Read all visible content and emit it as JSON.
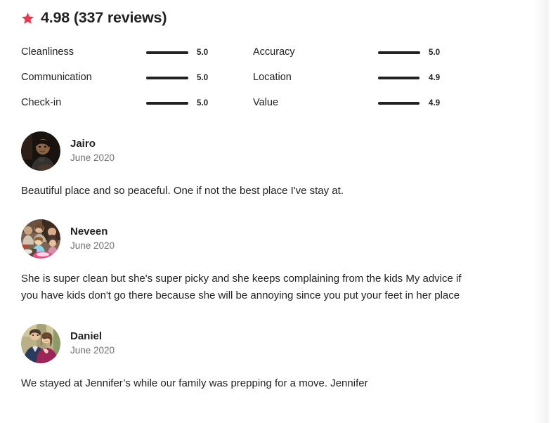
{
  "header": {
    "star_icon": "star-icon",
    "star_color": "#E8384F",
    "summary": "4.98 (337 reviews)",
    "rating_value": "4.98",
    "review_count": "337 reviews"
  },
  "categories": [
    {
      "label": "Cleanliness",
      "score": "5.0",
      "pct": 100
    },
    {
      "label": "Accuracy",
      "score": "5.0",
      "pct": 100
    },
    {
      "label": "Communication",
      "score": "5.0",
      "pct": 100
    },
    {
      "label": "Location",
      "score": "4.9",
      "pct": 98
    },
    {
      "label": "Check-in",
      "score": "5.0",
      "pct": 100
    },
    {
      "label": "Value",
      "score": "4.9",
      "pct": 98
    }
  ],
  "reviews": [
    {
      "name": "Jairo",
      "date": "June 2020",
      "text": "Beautiful place and so peaceful. One if not the best place I've stay at.",
      "avatar": "avatar-jairo"
    },
    {
      "name": "Neveen",
      "date": "June 2020",
      "text": "She is super clean but she's super picky and she keeps complaining from the kids My advice if you have kids don't go there because she will be annoying since you put your feet in her place",
      "avatar": "avatar-neveen"
    },
    {
      "name": "Daniel",
      "date": "June 2020",
      "text": "We stayed at  Jennifer’s while our family was prepping for a move.  Jennifer",
      "avatar": "avatar-daniel"
    }
  ]
}
